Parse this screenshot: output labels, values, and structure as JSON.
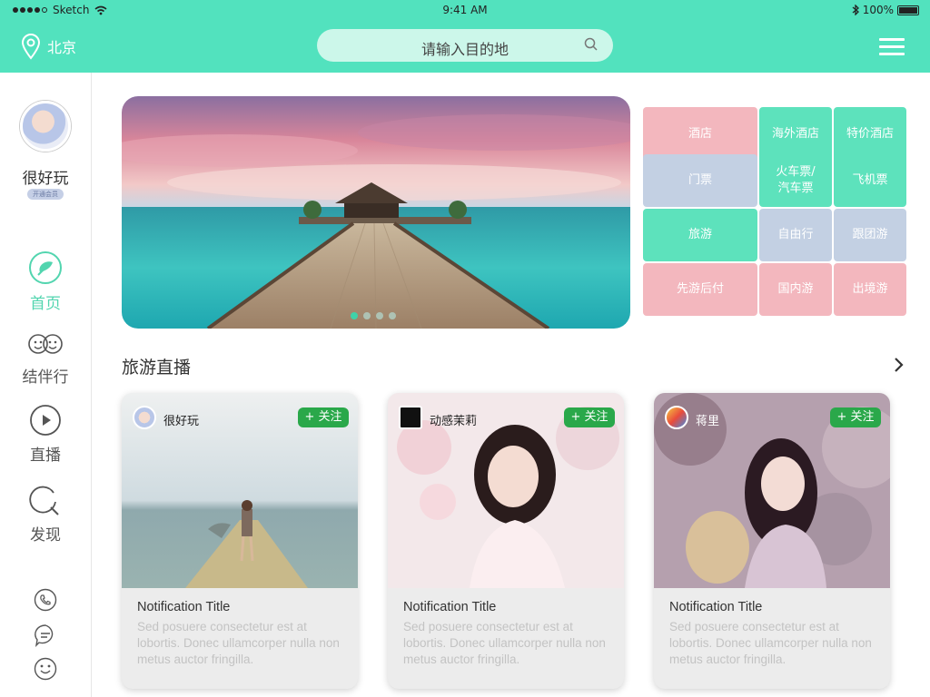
{
  "status": {
    "carrier": "Sketch",
    "time": "9:41 AM",
    "battery": "100%"
  },
  "header": {
    "location": "北京",
    "search_placeholder": "请输入目的地",
    "accent": "#52e2be"
  },
  "sidebar": {
    "username": "很好玩",
    "vip_label": "开通会员",
    "nav": [
      {
        "label": "首页",
        "icon": "home-icon",
        "active": true
      },
      {
        "label": "结伴行",
        "icon": "companions-icon",
        "active": false
      },
      {
        "label": "直播",
        "icon": "live-play-icon",
        "active": false
      },
      {
        "label": "发现",
        "icon": "discover-icon",
        "active": false
      }
    ],
    "bottom_icons": [
      "phone-icon",
      "chat-icon",
      "smile-icon"
    ]
  },
  "categories": [
    {
      "label": "酒店",
      "color": "pink"
    },
    {
      "label": "海外酒店",
      "color": "green"
    },
    {
      "label": "特价酒店",
      "color": "green"
    },
    {
      "label": "门票",
      "color": "blue"
    },
    {
      "label": "火车票/\n汽车票",
      "color": "green"
    },
    {
      "label": "飞机票",
      "color": "green"
    },
    {
      "label": "旅游",
      "color": "green"
    },
    {
      "label": "自由行",
      "color": "blue"
    },
    {
      "label": "跟团游",
      "color": "blue"
    },
    {
      "label": "先游后付",
      "color": "pink"
    },
    {
      "label": "国内游",
      "color": "pink"
    },
    {
      "label": "出境游",
      "color": "pink"
    }
  ],
  "live": {
    "section_title": "旅游直播",
    "cards": [
      {
        "user": "很好玩",
        "follow": "+ 关注",
        "title": "Notification Title",
        "body": "Sed posuere consectetur est at lobortis. Donec ullamcorper nulla non metus auctor fringilla."
      },
      {
        "user": "动感茉莉",
        "follow": "+ 关注",
        "title": "Notification Title",
        "body": "Sed posuere consectetur est at lobortis. Donec ullamcorper nulla non metus auctor fringilla."
      },
      {
        "user": "蒋里",
        "follow": "+ 关注",
        "title": "Notification Title",
        "body": "Sed posuere consectetur est at lobortis. Donec ullamcorper nulla non metus auctor fringilla."
      }
    ]
  }
}
